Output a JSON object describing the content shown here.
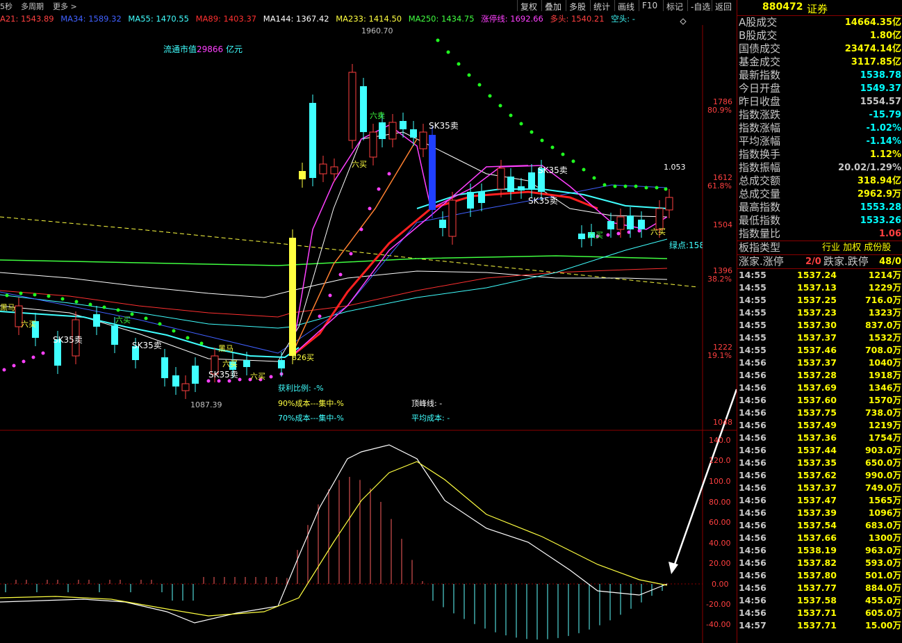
{
  "toolbar": {
    "left_items": [
      "5秒",
      "多周期",
      "更多 >"
    ],
    "buttons": [
      "复权",
      "叠加",
      "多股",
      "统计",
      "画线",
      "F10",
      "标记",
      "-自选",
      "返回"
    ]
  },
  "ma_legend": [
    {
      "text": "A21: 1543.89",
      "color": "#ff4040"
    },
    {
      "text": "MA34: 1589.32",
      "color": "#4060ff"
    },
    {
      "text": "MA55: 1470.55",
      "color": "#40ffff"
    },
    {
      "text": "MA89: 1403.37",
      "color": "#ff3030"
    },
    {
      "text": "MA144: 1367.42",
      "color": "#ffffff"
    },
    {
      "text": "MA233: 1414.50",
      "color": "#ffff40"
    },
    {
      "text": "MA250: 1434.75",
      "color": "#40ff40"
    },
    {
      "text": "涨停线: 1692.66",
      "color": "#ff40ff"
    },
    {
      "text": "多头: 1540.21",
      "color": "#ff4040"
    },
    {
      "text": "空头: -",
      "color": "#40ffff"
    }
  ],
  "chart": {
    "market_cap_label": "流通市值",
    "market_cap_value": "29866",
    "market_cap_unit": "亿元",
    "high_label": "1960.70",
    "low_label": "1087.39",
    "ratio_label": "1.053",
    "green_point_label": "绿点:158",
    "profit_ratio": "获利比例: -%",
    "cost90": "90%成本---集中-%",
    "cost70": "70%成本---集中-%",
    "peak_line": "顶峰线: -",
    "avg_cost": "平均成本: -",
    "annotations": [
      "六卖",
      "SK35卖",
      "六买",
      "SK35卖",
      "SK35卖",
      "六买",
      "黑马",
      "SK35卖",
      "六买",
      "826买",
      "SK35卖",
      "六买",
      "六买",
      "黑马",
      "六买",
      "SK35卖",
      "六买"
    ],
    "y_axis_main": [
      {
        "value": "1786",
        "pct": "80.9%"
      },
      {
        "value": "1612",
        "pct": "61.8%"
      },
      {
        "value": "1504",
        "pct": ""
      },
      {
        "value": "1396",
        "pct": "38.2%"
      },
      {
        "value": "1222",
        "pct": "19.1%"
      },
      {
        "value": "1048",
        "pct": ""
      }
    ],
    "y_axis_macd": [
      "140.0",
      "120.0",
      "100.0",
      "80.00",
      "60.00",
      "40.00",
      "20.00",
      "0.00",
      "-20.00",
      "-40.00"
    ]
  },
  "panel": {
    "code": "880472",
    "name": "证券",
    "stats": [
      {
        "label": "A股成交",
        "value": "14664.35亿",
        "color": "#ffff00"
      },
      {
        "label": "B股成交",
        "value": "1.80亿",
        "color": "#ffff00"
      },
      {
        "label": "国债成交",
        "value": "23474.14亿",
        "color": "#ffff00"
      },
      {
        "label": "基金成交",
        "value": "3117.85亿",
        "color": "#ffff00"
      },
      {
        "label": "最新指数",
        "value": "1538.78",
        "color": "#00ffff"
      },
      {
        "label": "今日开盘",
        "value": "1549.37",
        "color": "#00ffff"
      },
      {
        "label": "昨日收盘",
        "value": "1554.57",
        "color": "#c8c8c8"
      },
      {
        "label": "指数涨跌",
        "value": "-15.79",
        "color": "#00ffff"
      },
      {
        "label": "指数涨幅",
        "value": "-1.02%",
        "color": "#00ffff"
      },
      {
        "label": "平均涨幅",
        "value": "-1.14%",
        "color": "#00ffff"
      },
      {
        "label": "指数换手",
        "value": "1.12%",
        "color": "#ffff00"
      },
      {
        "label": "指数振幅",
        "value": "20.02/1.29%",
        "color": "#c8c8c8"
      },
      {
        "label": "总成交额",
        "value": "318.94亿",
        "color": "#ffff00"
      },
      {
        "label": "总成交量",
        "value": "2962.9万",
        "color": "#ffff00"
      },
      {
        "label": "最高指数",
        "value": "1553.28",
        "color": "#00ffff"
      },
      {
        "label": "最低指数",
        "value": "1533.26",
        "color": "#00ffff"
      },
      {
        "label": "指数量比",
        "value": "1.06",
        "color": "#ff4040"
      }
    ],
    "board_type_label": "板指类型",
    "board_type_value": "行业 加权 成份股",
    "up_down_label": "涨家.涨停",
    "up_down_value": "2/0",
    "fall_label": "跌家.跌停",
    "fall_value": "48/0",
    "ticks": [
      {
        "time": "14:55",
        "price": "1537.24",
        "vol": "1214万"
      },
      {
        "time": "14:55",
        "price": "1537.13",
        "vol": "1229万"
      },
      {
        "time": "14:55",
        "price": "1537.25",
        "vol": "716.0万"
      },
      {
        "time": "14:55",
        "price": "1537.23",
        "vol": "1323万"
      },
      {
        "time": "14:55",
        "price": "1537.30",
        "vol": "837.0万"
      },
      {
        "time": "14:55",
        "price": "1537.37",
        "vol": "1532万"
      },
      {
        "time": "14:55",
        "price": "1537.46",
        "vol": "708.0万"
      },
      {
        "time": "14:56",
        "price": "1537.37",
        "vol": "1040万"
      },
      {
        "time": "14:56",
        "price": "1537.28",
        "vol": "1918万"
      },
      {
        "time": "14:56",
        "price": "1537.69",
        "vol": "1346万"
      },
      {
        "time": "14:56",
        "price": "1537.60",
        "vol": "1570万"
      },
      {
        "time": "14:56",
        "price": "1537.75",
        "vol": "738.0万"
      },
      {
        "time": "14:56",
        "price": "1537.49",
        "vol": "1219万"
      },
      {
        "time": "14:56",
        "price": "1537.36",
        "vol": "1754万"
      },
      {
        "time": "14:56",
        "price": "1537.44",
        "vol": "903.0万"
      },
      {
        "time": "14:56",
        "price": "1537.35",
        "vol": "650.0万"
      },
      {
        "time": "14:56",
        "price": "1537.62",
        "vol": "990.0万"
      },
      {
        "time": "14:56",
        "price": "1537.37",
        "vol": "749.0万"
      },
      {
        "time": "14:56",
        "price": "1537.47",
        "vol": "1565万"
      },
      {
        "time": "14:56",
        "price": "1537.39",
        "vol": "1096万"
      },
      {
        "time": "14:56",
        "price": "1537.54",
        "vol": "683.0万"
      },
      {
        "time": "14:56",
        "price": "1537.66",
        "vol": "1300万"
      },
      {
        "time": "14:56",
        "price": "1538.19",
        "vol": "963.0万"
      },
      {
        "time": "14:56",
        "price": "1537.82",
        "vol": "593.0万"
      },
      {
        "time": "14:56",
        "price": "1537.80",
        "vol": "501.0万"
      },
      {
        "time": "14:56",
        "price": "1537.77",
        "vol": "884.0万"
      },
      {
        "time": "14:56",
        "price": "1537.58",
        "vol": "455.0万"
      },
      {
        "time": "14:56",
        "price": "1537.71",
        "vol": "605.0万"
      },
      {
        "time": "14:57",
        "price": "1537.71",
        "vol": "15.00万"
      }
    ]
  }
}
